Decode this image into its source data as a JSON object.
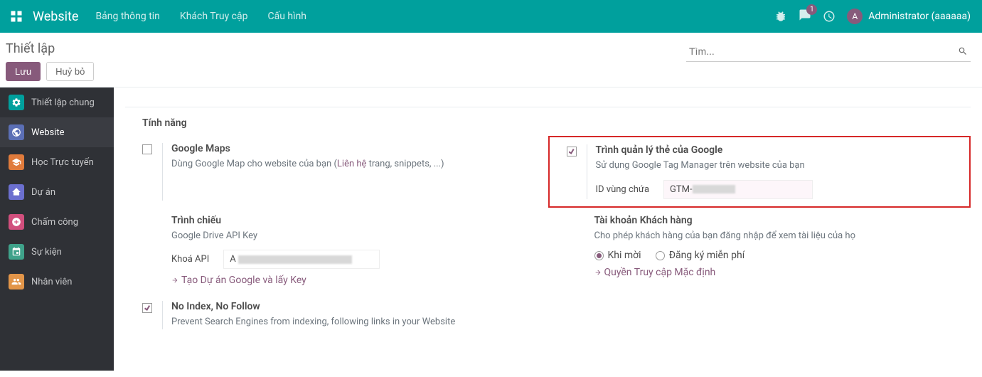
{
  "navbar": {
    "brand": "Website",
    "menu": [
      "Bảng thông tin",
      "Khách Truy cập",
      "Cấu hình"
    ],
    "badge": "1",
    "avatar_letter": "A",
    "user": "Administrator (aaaaaa)"
  },
  "control": {
    "breadcrumb": "Thiết lập",
    "save": "Lưu",
    "discard": "Huỷ bỏ",
    "search_placeholder": "Tìm..."
  },
  "sidebar": {
    "items": [
      {
        "label": "Thiết lập chung",
        "color": "#00a09d"
      },
      {
        "label": "Website",
        "color": "#5b6fb5"
      },
      {
        "label": "Học Trực tuyến",
        "color": "#e07b3c"
      },
      {
        "label": "Dự án",
        "color": "#6b6fcf"
      },
      {
        "label": "Chấm công",
        "color": "#d14f7d"
      },
      {
        "label": "Sự kiện",
        "color": "#3fa28a"
      },
      {
        "label": "Nhân viên",
        "color": "#e29549"
      }
    ]
  },
  "section_title": "Tính năng",
  "features": {
    "gmaps": {
      "title": "Google Maps",
      "desc_pre": "Dùng Google Map cho website của bạn (",
      "link": "Liên hệ",
      "desc_post": " trang, snippets, ...)"
    },
    "gtm": {
      "title": "Trình quản lý thẻ của Google",
      "desc": "Sử dụng Google Tag Manager trên website của bạn",
      "field_label": "ID vùng chứa",
      "field_value_prefix": "GTM-"
    },
    "slide": {
      "title": "Trình chiếu",
      "desc": "Google Drive API Key",
      "field_label": "Khoá API",
      "link": "Tạo Dự án Google và lấy Key"
    },
    "customer": {
      "title": "Tài khoản Khách hàng",
      "desc": "Cho phép khách hàng của bạn đăng nhập để xem tài liệu của họ",
      "radio1": "Khi mời",
      "radio2": "Đăng ký miễn phí",
      "link": "Quyền Truy cập Mặc định"
    },
    "noindex": {
      "title": "No Index, No Follow",
      "desc": "Prevent Search Engines from indexing, following links in your Website"
    }
  }
}
